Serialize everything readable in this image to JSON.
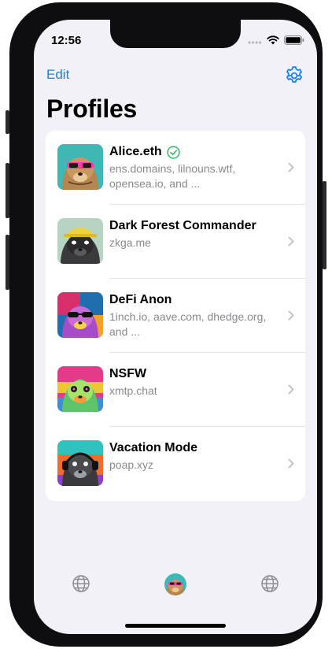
{
  "status_bar": {
    "time": "12:56"
  },
  "nav": {
    "edit_label": "Edit",
    "settings_icon": "gear-icon",
    "title": "Profiles"
  },
  "profiles": [
    {
      "name": "Alice.eth",
      "subtitle": "ens.domains, lilnouns.wtf, opensea.io, and ...",
      "verified": true,
      "avatar": "otter-pink-sunglasses"
    },
    {
      "name": "Dark Forest Commander",
      "subtitle": "zkga.me",
      "verified": false,
      "avatar": "otter-yellow-cap"
    },
    {
      "name": "DeFi Anon",
      "subtitle": "1inch.io, aave.com, dhedge.org, and ...",
      "verified": false,
      "avatar": "otter-rainbow-sunglasses"
    },
    {
      "name": "NSFW",
      "subtitle": "xmtp.chat",
      "verified": false,
      "avatar": "otter-psychedelic"
    },
    {
      "name": "Vacation Mode",
      "subtitle": "poap.xyz",
      "verified": false,
      "avatar": "otter-headphones"
    }
  ],
  "tab_bar": {
    "items": [
      "globe-icon",
      "profile-avatar",
      "globe-icon"
    ]
  },
  "colors": {
    "accent": "#1a82ef",
    "verified": "#2fb866",
    "background": "#f2f1f7",
    "secondary_text": "#8a8a8e"
  }
}
